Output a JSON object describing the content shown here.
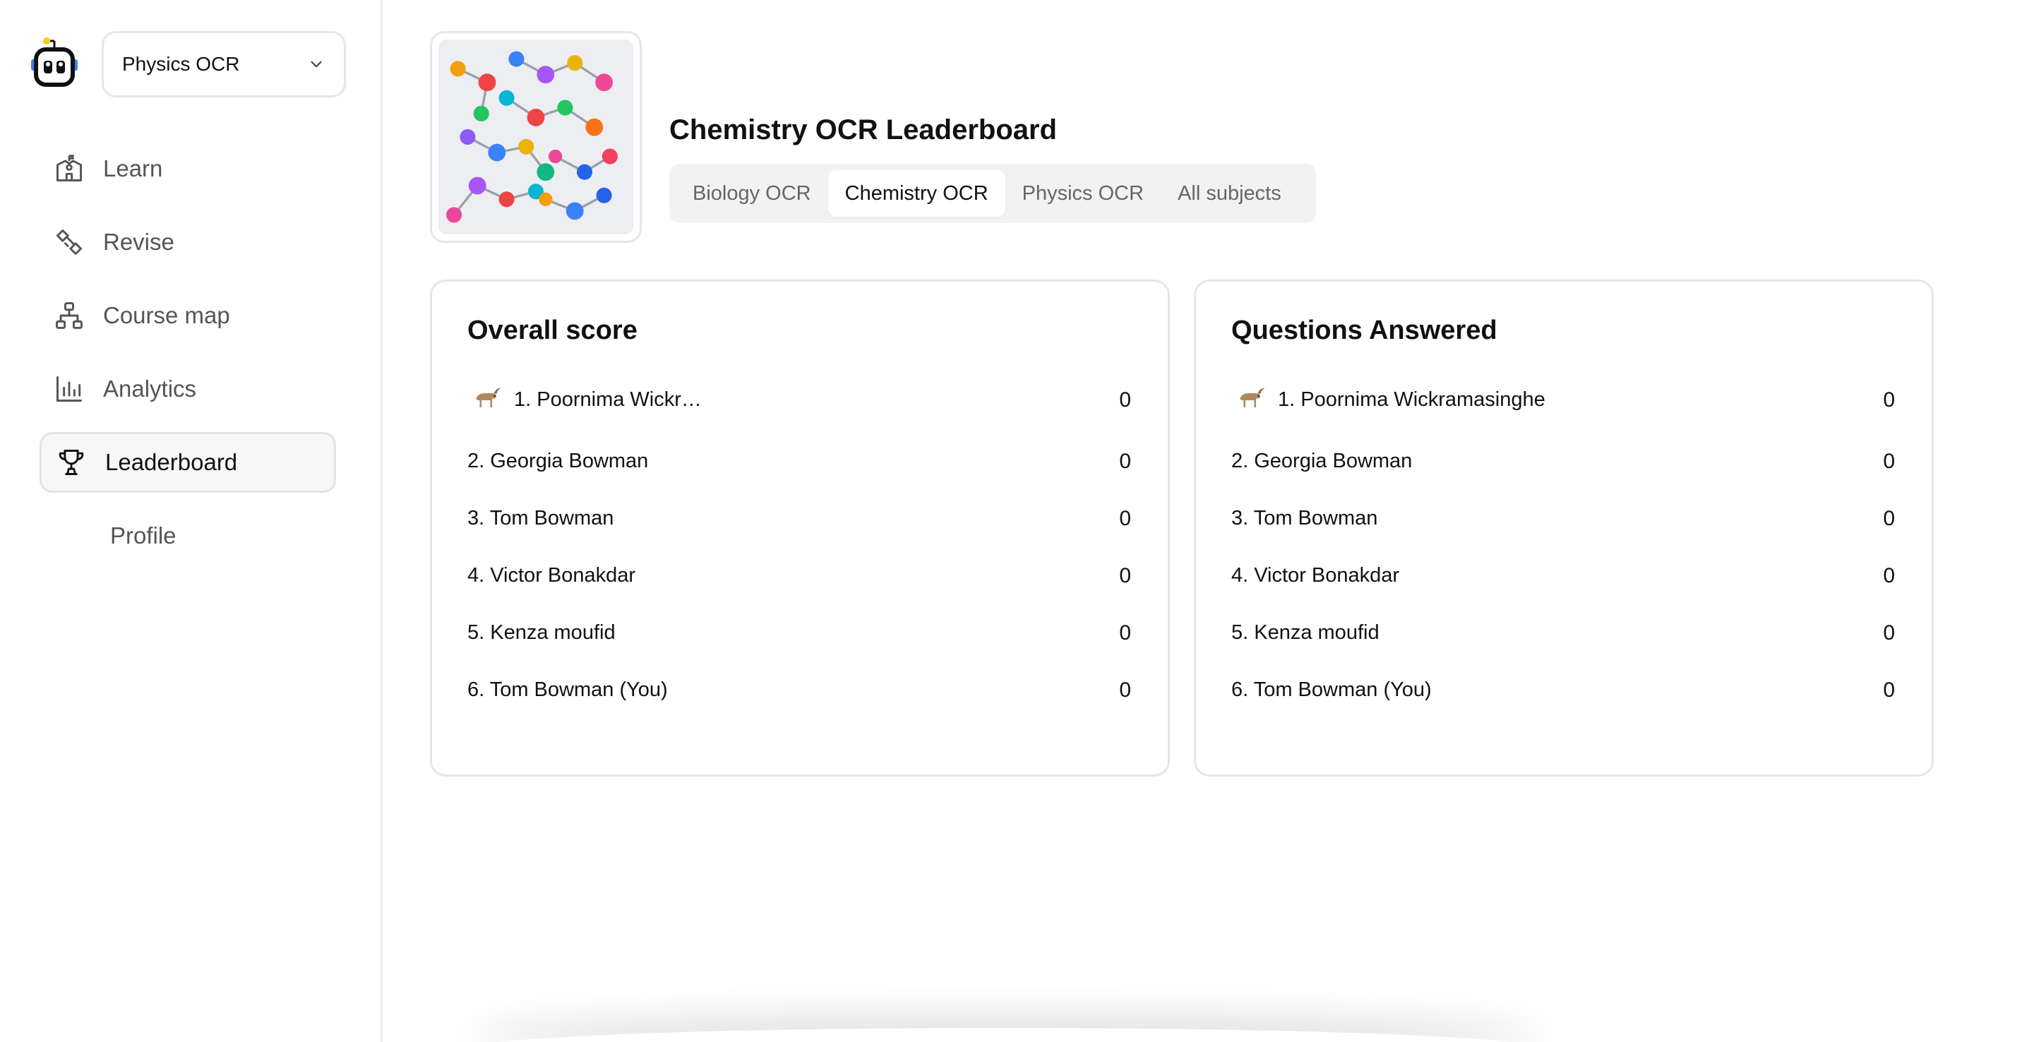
{
  "sidebar": {
    "subject_select": {
      "value": "Physics OCR"
    },
    "nav": [
      {
        "label": "Learn",
        "icon": "school-building-icon"
      },
      {
        "label": "Revise",
        "icon": "revise-icon"
      },
      {
        "label": "Course map",
        "icon": "course-map-icon"
      },
      {
        "label": "Analytics",
        "icon": "bar-chart-icon"
      },
      {
        "label": "Leaderboard",
        "icon": "trophy-icon",
        "active": true
      },
      {
        "label": "Profile"
      }
    ]
  },
  "header": {
    "title": "Chemistry OCR Leaderboard",
    "tabs": [
      {
        "label": "Biology OCR"
      },
      {
        "label": "Chemistry OCR",
        "active": true
      },
      {
        "label": "Physics OCR"
      },
      {
        "label": "All subjects"
      }
    ]
  },
  "overall": {
    "title": "Overall score",
    "rows": [
      {
        "name": "1. Poornima Wickra...",
        "score": "0",
        "goat": true
      },
      {
        "name": "2. Georgia Bowman",
        "score": "0"
      },
      {
        "name": "3. Tom Bowman",
        "score": "0"
      },
      {
        "name": "4. Victor Bonakdar",
        "score": "0"
      },
      {
        "name": "5. Kenza moufid",
        "score": "0"
      },
      {
        "name": "6. Tom Bowman (You)",
        "score": "0"
      }
    ]
  },
  "answered": {
    "title": "Questions Answered",
    "rows": [
      {
        "name": "1. Poornima Wickramasinghe",
        "score": "0",
        "goat": true
      },
      {
        "name": "2. Georgia Bowman",
        "score": "0"
      },
      {
        "name": "3. Tom Bowman",
        "score": "0"
      },
      {
        "name": "4. Victor Bonakdar",
        "score": "0"
      },
      {
        "name": "5. Kenza moufid",
        "score": "0"
      },
      {
        "name": "6. Tom Bowman (You)",
        "score": "0"
      }
    ]
  },
  "colors": {
    "active_bg": "#f7f7f8",
    "border": "#e6e6e6",
    "tab_track": "#f2f2f3",
    "muted_text": "#666666",
    "logo_blue": "#3b82f6",
    "logo_yellow": "#facc15"
  }
}
